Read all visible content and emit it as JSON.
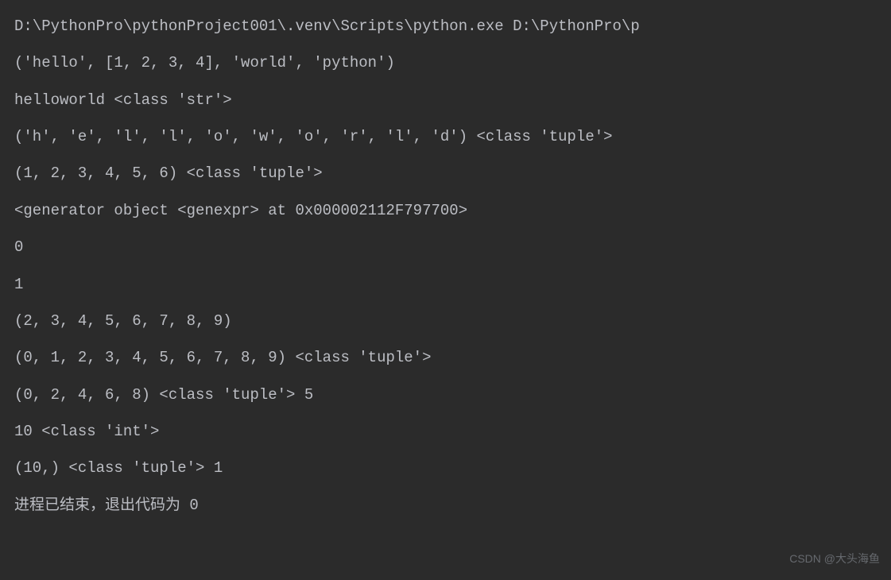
{
  "console": {
    "lines": [
      "D:\\PythonPro\\pythonProject001\\.venv\\Scripts\\python.exe D:\\PythonPro\\p",
      "('hello', [1, 2, 3, 4], 'world', 'python')",
      "helloworld <class 'str'>",
      "('h', 'e', 'l', 'l', 'o', 'w', 'o', 'r', 'l', 'd') <class 'tuple'>",
      "(1, 2, 3, 4, 5, 6) <class 'tuple'>",
      "<generator object <genexpr> at 0x000002112F797700>",
      "0",
      "1",
      "(2, 3, 4, 5, 6, 7, 8, 9)",
      "(0, 1, 2, 3, 4, 5, 6, 7, 8, 9) <class 'tuple'>",
      "(0, 2, 4, 6, 8) <class 'tuple'> 5",
      "10 <class 'int'>",
      "(10,) <class 'tuple'> 1",
      "",
      "进程已结束，退出代码为 0"
    ]
  },
  "watermark": "CSDN @大头海鱼"
}
